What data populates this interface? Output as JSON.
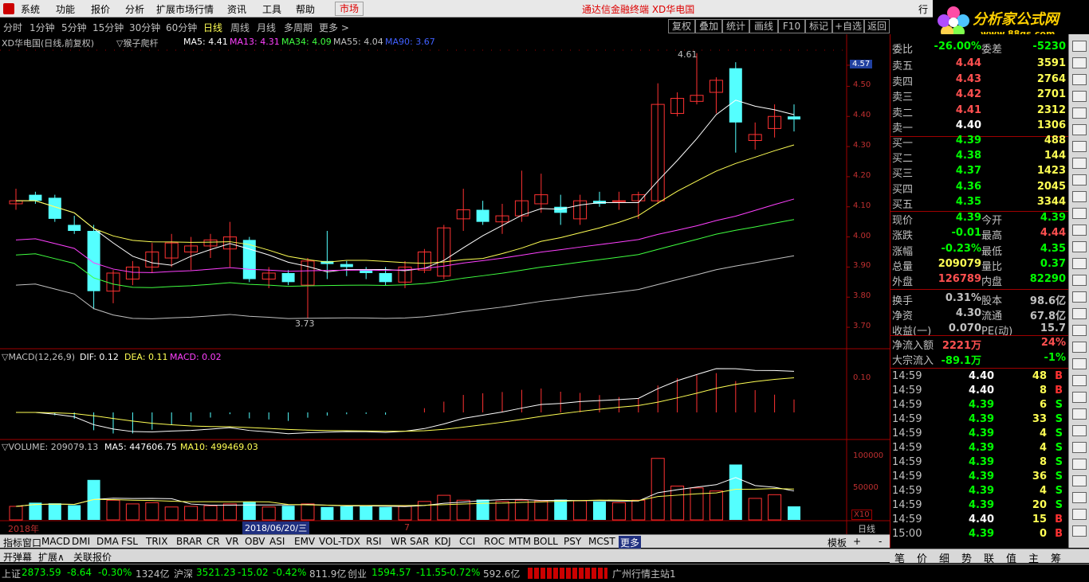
{
  "menu": {
    "items": [
      "系统",
      "功能",
      "报价",
      "分析",
      "扩展市场行情",
      "资讯",
      "工具",
      "帮助"
    ],
    "market": "市场",
    "title": "通达信金融终端  XD华电国",
    "win_trade": "行"
  },
  "logo": {
    "text": "分析家公式网",
    "url": "www.88gs.com"
  },
  "periods": [
    "分时",
    "1分钟",
    "5分钟",
    "15分钟",
    "30分钟",
    "60分钟",
    "日线",
    "周线",
    "月线",
    "多周期",
    "更多 >"
  ],
  "toolbtns": [
    "复权",
    "叠加",
    "统计",
    "画线",
    "F10",
    "标记",
    "+自选",
    "返回"
  ],
  "main_header": {
    "name": "XD华电国(日线,前复权)",
    "ind": "▽猴子爬杆",
    "ma5": "MA5: 4.41",
    "ma13": "MA13: 4.31",
    "ma34": "MA34: 4.09",
    "ma55": "MA55: 4.04",
    "ma90": "MA90: 3.67"
  },
  "price_axis": [
    "4.57",
    "4.50",
    "4.40",
    "4.30",
    "4.20",
    "4.10",
    "4.00",
    "3.90",
    "3.80",
    "3.70"
  ],
  "annotations": {
    "high": "4.61",
    "low": "3.73"
  },
  "macd": {
    "title": "▽MACD(12,26,9)",
    "dif": "DIF: 0.12",
    "dea": "DEA: 0.11",
    "macd": "MACD: 0.02",
    "axis": "0.10"
  },
  "volume": {
    "title": "▽VOLUME: 209079.13",
    "ma5": "MA5: 447606.75",
    "ma10": "MA10: 499469.03",
    "axis": [
      "100000",
      "50000"
    ],
    "unit": "X10"
  },
  "date_axis": {
    "year": "2018年",
    "cursor": "2018/06/20/三",
    "mark": "7",
    "period": "日线"
  },
  "indicators": [
    "指标",
    "窗口",
    "MACD",
    "DMI",
    "DMA",
    "FSL",
    "TRIX",
    "BRAR",
    "CR",
    "VR",
    "OBV",
    "ASI",
    "EMV",
    "VOL-TDX",
    "RSI",
    "WR",
    "SAR",
    "KDJ",
    "CCI",
    "ROC",
    "MTM",
    "BOLL",
    "PSY",
    "MCST",
    "更多"
  ],
  "indicators_right": [
    "模板",
    "+",
    "-"
  ],
  "bottom_tabs": [
    "开弹幕",
    "扩展∧",
    "关联报价"
  ],
  "right_bottom": [
    "笔",
    "价",
    "细",
    "势",
    "联",
    "值",
    "主",
    "筹"
  ],
  "quote": {
    "webi": {
      "label": "委比",
      "val": "-26.00%",
      "label2": "委差",
      "val2": "-5230"
    },
    "asks": [
      {
        "l": "卖五",
        "p": "4.44",
        "v": "3591"
      },
      {
        "l": "卖四",
        "p": "4.43",
        "v": "2764"
      },
      {
        "l": "卖三",
        "p": "4.42",
        "v": "2701"
      },
      {
        "l": "卖二",
        "p": "4.41",
        "v": "2312"
      },
      {
        "l": "卖一",
        "p": "4.40",
        "v": "1306"
      }
    ],
    "bids": [
      {
        "l": "买一",
        "p": "4.39",
        "v": "488"
      },
      {
        "l": "买二",
        "p": "4.38",
        "v": "144"
      },
      {
        "l": "买三",
        "p": "4.37",
        "v": "1423"
      },
      {
        "l": "买四",
        "p": "4.36",
        "v": "2045"
      },
      {
        "l": "买五",
        "p": "4.35",
        "v": "3344"
      }
    ],
    "stats": [
      {
        "a": "现价",
        "b": "4.39",
        "d": "今开",
        "c": "4.39",
        "bc": "#00ff00",
        "cc": "#00ff00"
      },
      {
        "a": "涨跌",
        "b": "-0.01",
        "d": "最高",
        "c": "4.44",
        "bc": "#00ff00",
        "cc": "#ff5050"
      },
      {
        "a": "涨幅",
        "b": "-0.23%",
        "d": "最低",
        "c": "4.35",
        "bc": "#00ff00",
        "cc": "#00ff00"
      },
      {
        "a": "总量",
        "b": "209079",
        "d": "量比",
        "c": "0.37",
        "bc": "#ffff54",
        "cc": "#00ff00"
      },
      {
        "a": "外盘",
        "b": "126789",
        "d": "内盘",
        "c": "82290",
        "bc": "#ff5050",
        "cc": "#00ff00"
      },
      {
        "a": "换手",
        "b": "0.31%",
        "d": "股本",
        "c": "98.6亿",
        "bc": "#c0c0c0",
        "cc": "#c0c0c0"
      },
      {
        "a": "净资",
        "b": "4.30",
        "d": "流通",
        "c": "67.8亿",
        "bc": "#c0c0c0",
        "cc": "#c0c0c0"
      },
      {
        "a": "收益(一)",
        "b": "0.070",
        "d": "PE(动)",
        "c": "15.7",
        "bc": "#c0c0c0",
        "cc": "#c0c0c0"
      }
    ],
    "flow": [
      {
        "a": "净流入额",
        "b": "2221万",
        "c": "24%"
      },
      {
        "a": "大宗流入",
        "b": "-89.1万",
        "c": "-1%"
      }
    ],
    "ticks": [
      {
        "t": "14:59",
        "p": "4.40",
        "v": "48",
        "s": "B"
      },
      {
        "t": "14:59",
        "p": "4.40",
        "v": "8",
        "s": "B"
      },
      {
        "t": "14:59",
        "p": "4.39",
        "v": "6",
        "s": "S"
      },
      {
        "t": "14:59",
        "p": "4.39",
        "v": "33",
        "s": "S"
      },
      {
        "t": "14:59",
        "p": "4.39",
        "v": "4",
        "s": "S"
      },
      {
        "t": "14:59",
        "p": "4.39",
        "v": "4",
        "s": "S"
      },
      {
        "t": "14:59",
        "p": "4.39",
        "v": "8",
        "s": "S"
      },
      {
        "t": "14:59",
        "p": "4.39",
        "v": "36",
        "s": "S"
      },
      {
        "t": "14:59",
        "p": "4.39",
        "v": "4",
        "s": "S"
      },
      {
        "t": "14:59",
        "p": "4.39",
        "v": "20",
        "s": "S"
      },
      {
        "t": "14:59",
        "p": "4.40",
        "v": "15",
        "s": "B"
      },
      {
        "t": "15:00",
        "p": "4.39",
        "v": "0",
        "s": "B"
      }
    ]
  },
  "status": {
    "sh": "上证",
    "shv": "2873.59",
    "shc": "-8.64",
    "shp": "-0.30%",
    "sha": "1324亿",
    "sz": "沪深",
    "szv": "3521.23",
    "szc": "-15.02",
    "szp": "-0.42%",
    "sza": "811.9亿",
    "cy": "创业",
    "cyv": "1594.57",
    "cyc": "-11.55",
    "cyp": "-0.72%",
    "cya": "592.6亿",
    "server": "广州行情主站1"
  },
  "chart_data": {
    "type": "candlestick",
    "ylim": [
      3.65,
      4.62
    ],
    "candles": [
      {
        "o": 4.11,
        "h": 4.16,
        "l": 4.09,
        "c": 4.12
      },
      {
        "o": 4.14,
        "h": 4.15,
        "l": 4.11,
        "c": 4.12
      },
      {
        "o": 4.13,
        "h": 4.14,
        "l": 4.05,
        "c": 4.06
      },
      {
        "o": 4.04,
        "h": 4.07,
        "l": 4.01,
        "c": 4.02
      },
      {
        "o": 4.02,
        "h": 4.04,
        "l": 3.76,
        "c": 3.82
      },
      {
        "o": 3.82,
        "h": 3.89,
        "l": 3.78,
        "c": 3.88
      },
      {
        "o": 3.86,
        "h": 3.92,
        "l": 3.84,
        "c": 3.9
      },
      {
        "o": 3.9,
        "h": 3.98,
        "l": 3.88,
        "c": 3.95
      },
      {
        "o": 3.93,
        "h": 4.01,
        "l": 3.9,
        "c": 3.98
      },
      {
        "o": 3.95,
        "h": 4.0,
        "l": 3.89,
        "c": 3.97
      },
      {
        "o": 3.97,
        "h": 4.01,
        "l": 3.93,
        "c": 3.99
      },
      {
        "o": 3.96,
        "h": 4.05,
        "l": 3.9,
        "c": 4.0
      },
      {
        "o": 3.99,
        "h": 4.0,
        "l": 3.85,
        "c": 3.86
      },
      {
        "o": 3.86,
        "h": 3.9,
        "l": 3.83,
        "c": 3.88
      },
      {
        "o": 3.88,
        "h": 3.89,
        "l": 3.84,
        "c": 3.85
      },
      {
        "o": 3.84,
        "h": 3.93,
        "l": 3.73,
        "c": 3.92
      },
      {
        "o": 3.92,
        "h": 4.02,
        "l": 3.86,
        "c": 3.91
      },
      {
        "o": 3.91,
        "h": 3.92,
        "l": 3.87,
        "c": 3.9
      },
      {
        "o": 3.89,
        "h": 3.9,
        "l": 3.86,
        "c": 3.88
      },
      {
        "o": 3.88,
        "h": 3.9,
        "l": 3.84,
        "c": 3.85
      },
      {
        "o": 3.85,
        "h": 3.92,
        "l": 3.83,
        "c": 3.9
      },
      {
        "o": 3.89,
        "h": 3.96,
        "l": 3.88,
        "c": 3.95
      },
      {
        "o": 3.87,
        "h": 4.04,
        "l": 3.86,
        "c": 4.03
      },
      {
        "o": 4.06,
        "h": 4.16,
        "l": 4.02,
        "c": 4.09
      },
      {
        "o": 4.09,
        "h": 4.12,
        "l": 4.04,
        "c": 4.05
      },
      {
        "o": 4.05,
        "h": 4.11,
        "l": 4.01,
        "c": 4.07
      },
      {
        "o": 4.07,
        "h": 4.22,
        "l": 4.05,
        "c": 4.12
      },
      {
        "o": 4.11,
        "h": 4.21,
        "l": 4.08,
        "c": 4.14
      },
      {
        "o": 4.1,
        "h": 4.14,
        "l": 4.04,
        "c": 4.08
      },
      {
        "o": 4.06,
        "h": 4.14,
        "l": 4.04,
        "c": 4.12
      },
      {
        "o": 4.12,
        "h": 4.15,
        "l": 4.1,
        "c": 4.11
      },
      {
        "o": 4.12,
        "h": 4.15,
        "l": 4.09,
        "c": 4.12
      },
      {
        "o": 4.12,
        "h": 4.15,
        "l": 4.06,
        "c": 4.14
      },
      {
        "o": 4.12,
        "h": 4.51,
        "l": 4.11,
        "c": 4.44
      },
      {
        "o": 4.41,
        "h": 4.48,
        "l": 4.4,
        "c": 4.46
      },
      {
        "o": 4.45,
        "h": 4.61,
        "l": 4.44,
        "c": 4.47
      },
      {
        "o": 4.48,
        "h": 4.53,
        "l": 4.41,
        "c": 4.52
      },
      {
        "o": 4.56,
        "h": 4.58,
        "l": 4.28,
        "c": 4.38
      },
      {
        "o": 4.32,
        "h": 4.38,
        "l": 4.29,
        "c": 4.34
      },
      {
        "o": 4.36,
        "h": 4.44,
        "l": 4.33,
        "c": 4.4
      },
      {
        "o": 4.4,
        "h": 4.44,
        "l": 4.35,
        "c": 4.39
      }
    ],
    "volume": [
      22000,
      28000,
      27000,
      24000,
      65000,
      32000,
      26000,
      28000,
      21000,
      22000,
      23000,
      26000,
      29000,
      21000,
      23000,
      26000,
      21000,
      22000,
      22000,
      21000,
      22000,
      30000,
      40000,
      32000,
      33000,
      30000,
      32000,
      31000,
      33000,
      31000,
      30000,
      28000,
      32000,
      100000,
      55000,
      52000,
      47000,
      90000,
      35000,
      41000,
      22000
    ]
  }
}
